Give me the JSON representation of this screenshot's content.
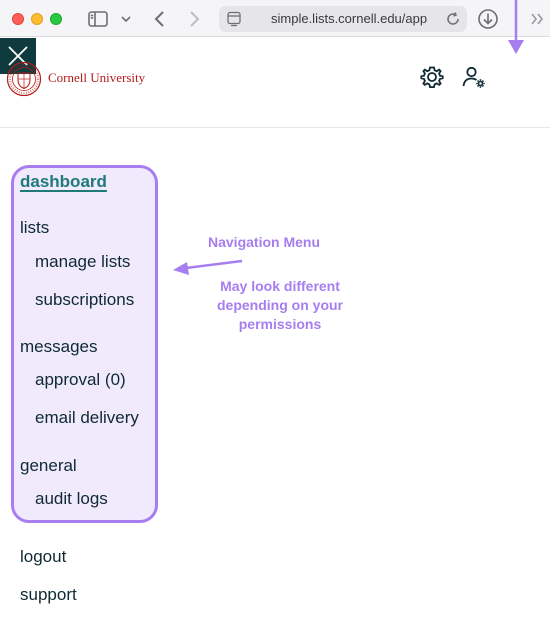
{
  "browser": {
    "url": "simple.lists.cornell.edu/app",
    "icons": [
      "sidebar-icon",
      "chevron-down-icon",
      "back-arrow-icon",
      "forward-arrow-icon",
      "page-icon",
      "reload-icon",
      "download-icon",
      "overflow-chevrons-icon"
    ]
  },
  "header": {
    "brand": "Cornell University",
    "brand_color": "#b31b1b",
    "icons": [
      "settings-icon",
      "account-settings-icon",
      "close-icon"
    ]
  },
  "nav": {
    "dashboard": "dashboard",
    "lists_heading": "lists",
    "manage_lists": "manage lists",
    "subscriptions": "subscriptions",
    "messages_heading": "messages",
    "approval": "approval (0)",
    "email_delivery": "email delivery",
    "general_heading": "general",
    "audit_logs": "audit logs",
    "logout": "logout",
    "support": "support"
  },
  "annotation": {
    "title": "Navigation Menu",
    "note": "May look different depending on your permissions",
    "color": "#a77ef0"
  },
  "colors": {
    "text": "#0f2a33",
    "active_link": "#1f7a7a",
    "close_button_bg": "#0f3a3e"
  }
}
